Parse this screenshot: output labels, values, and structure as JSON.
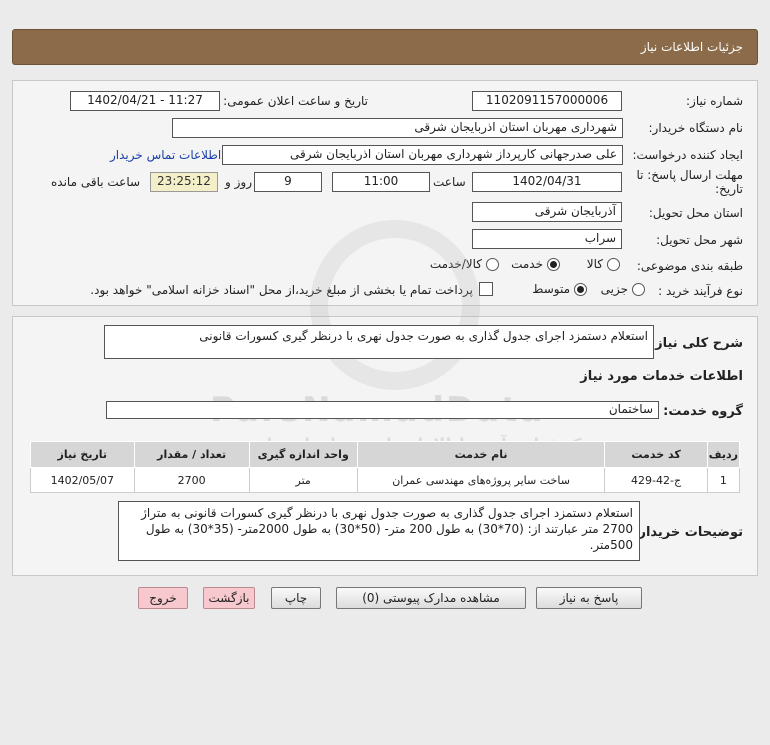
{
  "header": {
    "title": "جزئیات اطلاعات نیاز"
  },
  "form": {
    "need_number_label": "شماره نیاز:",
    "need_number": "1102091157000006",
    "announce_label": "تاریخ و ساعت اعلان عمومی:",
    "announce_value": "1402/04/21 - 11:27",
    "buyer_org_label": "نام دستگاه خریدار:",
    "buyer_org": "شهرداری مهربان استان اذربایجان شرقی",
    "creator_label": "ایجاد کننده درخواست:",
    "creator": "علی  صدرجهانی  کارپرداز شهرداری مهربان استان اذربایجان شرقی",
    "contact_link": "اطلاعات تماس خریدار",
    "deadline_label_1": "مهلت ارسال پاسخ: تا",
    "deadline_label_2": "تاریخ:",
    "deadline_date": "1402/04/31",
    "time_label": "ساعت",
    "deadline_time": "11:00",
    "days_value": "9",
    "days_label": "روز و",
    "remaining_time": "23:25:12",
    "remaining_label": "ساعت باقی مانده",
    "province_label": "استان محل تحویل:",
    "province": "آذربایجان شرقی",
    "city_label": "شهر محل تحویل:",
    "city": "سراب",
    "category_label": "طبقه بندی موضوعی:",
    "category_options": [
      "کالا",
      "خدمت",
      "کالا/خدمت"
    ],
    "category_selected": "خدمت",
    "process_label": "نوع فرآیند خرید :",
    "process_options": [
      "جزیی",
      "متوسط"
    ],
    "process_selected": "متوسط",
    "payment_note": "پرداخت تمام یا بخشی از مبلغ خرید،از محل \"اسناد خزانه اسلامی\" خواهد بود."
  },
  "summary": {
    "title_label": "شرح کلی نیاز:",
    "title_value": "استعلام دستمزد اجرای جدول گذاری به صورت جدول نهری با درنظر گیری کسورات قانونی",
    "services_heading": "اطلاعات خدمات مورد نیاز",
    "service_group_label": "گروه خدمت:",
    "service_group": "ساختمان",
    "table": {
      "headers": [
        "ردیف",
        "کد خدمت",
        "نام خدمت",
        "واحد اندازه گیری",
        "تعداد / مقدار",
        "تاریخ نیاز"
      ],
      "rows": [
        [
          "1",
          "ج-42-429",
          "ساخت سایر پروژه‌های مهندسی عمران",
          "متر",
          "2700",
          "1402/05/07"
        ]
      ]
    },
    "buyer_desc_label": "توضیحات خریدار:",
    "buyer_desc": "استعلام دستمزد اجرای جدول گذاری به صورت جدول نهری با درنظر گیری کسورات قانونی به متراژ 2700 متر عبارتند از: (70*30) به طول 200 متر- (50*30) به طول 2000متر- (35*30) به طول 500متر."
  },
  "buttons": {
    "reply": "پاسخ به نیاز",
    "attachments": "مشاهده مدارک پیوستی (0)",
    "print": "چاپ",
    "back": "بازگشت",
    "exit": "خروج"
  },
  "watermark": {
    "brand": "ParsNamadData",
    "line1": "مرکز فراهم آوری اطلاعات پارس نماد داده ها",
    "line2": "پایگاه خبررسانی مناقصه و مزایده"
  }
}
